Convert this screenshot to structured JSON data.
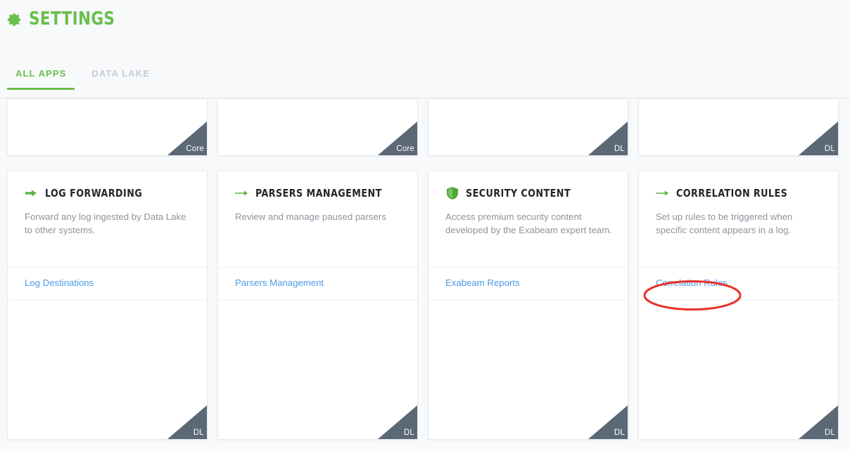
{
  "header": {
    "title": "SETTINGS",
    "icon": "gear-icon"
  },
  "tabs": [
    {
      "label": "ALL APPS",
      "active": true
    },
    {
      "label": "DATA LAKE",
      "active": false
    }
  ],
  "colors": {
    "brand_green": "#6abf4b",
    "link_blue": "#4a9ae4",
    "ribbon_slate": "#5b6876",
    "annotation_red": "#e8312a",
    "page_background": "#f7f9fb",
    "title_dark": "#22262c",
    "description_gray": "#8c949d"
  },
  "top_row_cards": [
    {
      "ribbon": "Core"
    },
    {
      "ribbon": "Core"
    },
    {
      "ribbon": "DL"
    },
    {
      "ribbon": "DL"
    }
  ],
  "cards": [
    {
      "icon": "arrow-right-bold-icon",
      "title": "LOG FORWARDING",
      "description": "Forward any log ingested by Data Lake to other systems.",
      "link": "Log Destinations",
      "ribbon": "DL"
    },
    {
      "icon": "arrow-right-thin-icon",
      "title": "PARSERS MANAGEMENT",
      "description": "Review and manage paused parsers",
      "link": "Parsers Management",
      "ribbon": "DL"
    },
    {
      "icon": "shield-icon",
      "title": "SECURITY CONTENT",
      "description": "Access premium security content developed by the Exabeam expert team.",
      "link": "Exabeam Reports",
      "ribbon": "DL"
    },
    {
      "icon": "arrow-right-thin-icon",
      "title": "CORRELATION RULES",
      "description": "Set up rules to be triggered when specific content appears in a log.",
      "link": "Correlation Rules",
      "ribbon": "DL"
    }
  ],
  "annotation": {
    "shape": "ellipse",
    "target": "Correlation Rules"
  }
}
